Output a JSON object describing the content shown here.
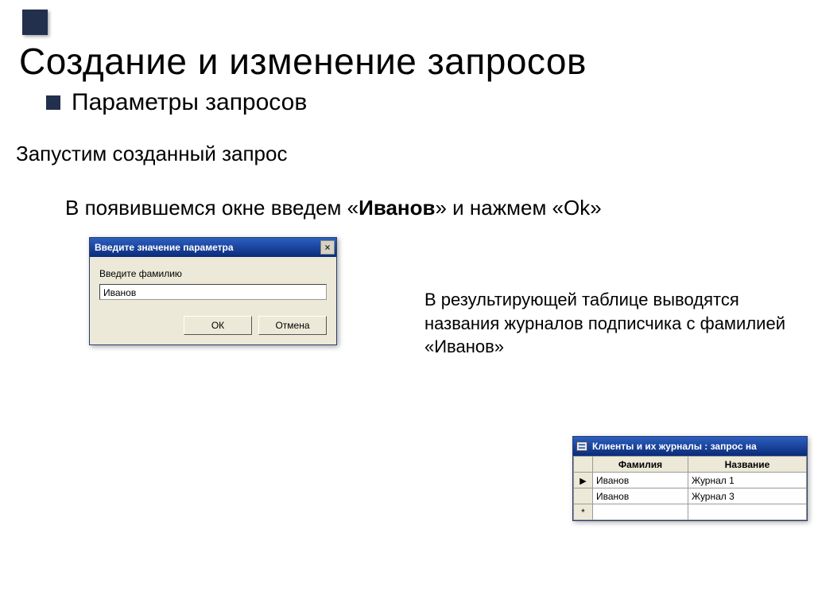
{
  "slide": {
    "title": "Создание и изменение запросов",
    "subtitle": "Параметры запросов",
    "line1": "Запустим созданный запрос",
    "line2_pre": "В появившемся окне введем «",
    "line2_bold": "Иванов",
    "line2_post": "» и нажмем «Ok»"
  },
  "dialog": {
    "title": "Введите значение параметра",
    "close_label": "×",
    "label": "Введите фамилию",
    "input_value": "Иванов",
    "ok_label": "ОК",
    "cancel_label": "Отмена"
  },
  "side_para": "В результирующей таблице выводятся названия журналов подписчика с фамилией «Иванов»",
  "result": {
    "title": "Клиенты и их журналы : запрос на",
    "headers": {
      "col1": "Фамилия",
      "col2": "Название"
    },
    "row_markers": {
      "current": "▶",
      "new": "*"
    },
    "rows": [
      {
        "col1": "Иванов",
        "col2": "Журнал 1"
      },
      {
        "col1": "Иванов",
        "col2": "Журнал 3"
      }
    ]
  }
}
